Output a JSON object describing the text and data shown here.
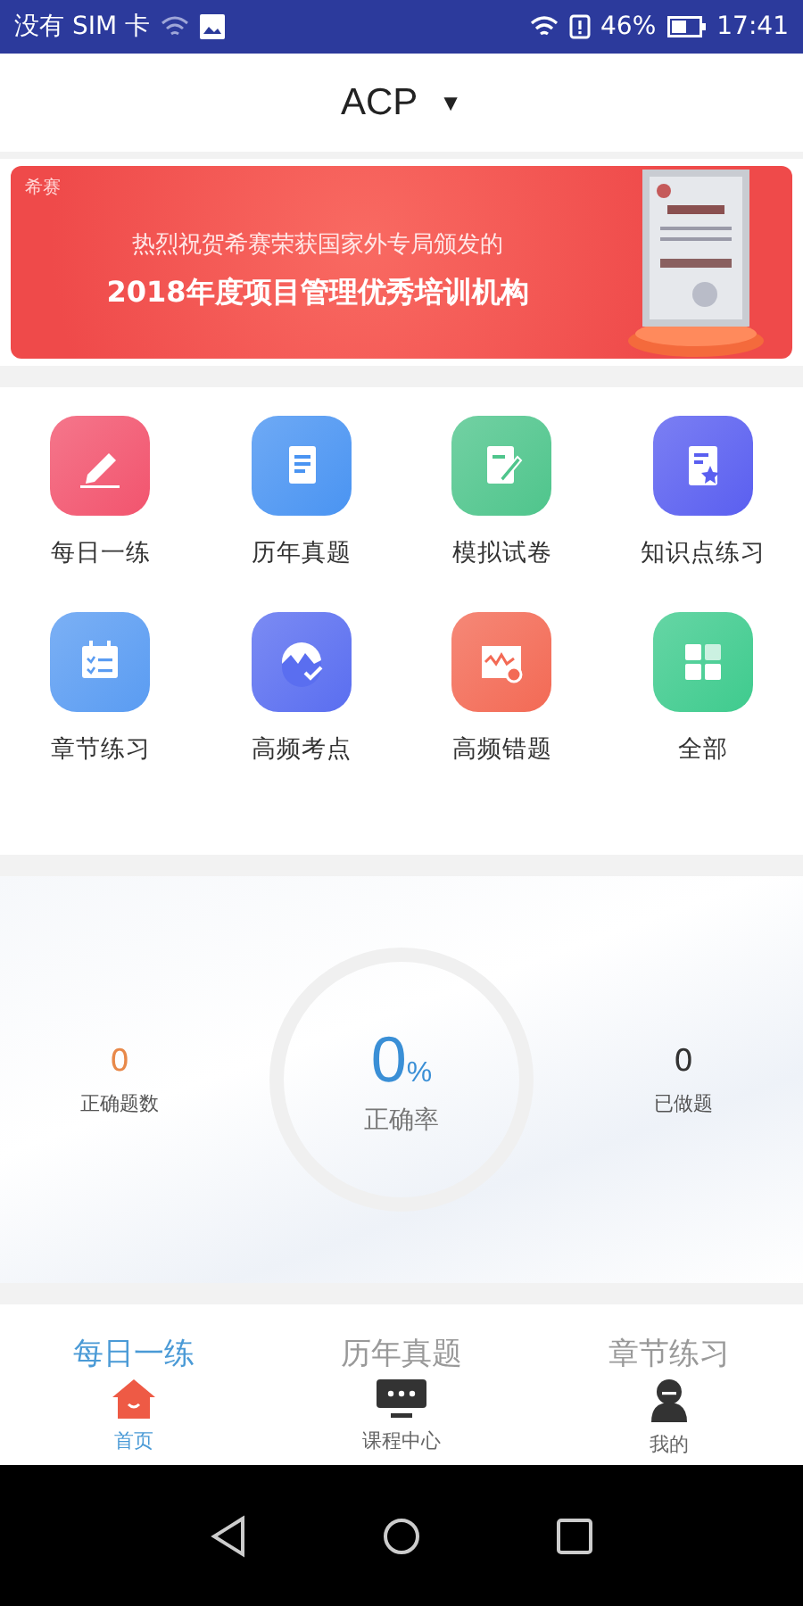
{
  "status_bar": {
    "carrier": "没有 SIM 卡",
    "battery": "46%",
    "time": "17:41"
  },
  "header": {
    "title": "ACP",
    "caret": "▼"
  },
  "banner": {
    "logo": "希赛",
    "line1": "热烈祝贺希赛荣获国家外专局颁发的",
    "line2": "2018年度项目管理优秀培训机构"
  },
  "grid": [
    {
      "label": "每日一练",
      "color": "#f2546e"
    },
    {
      "label": "历年真题",
      "color": "#4a94f2"
    },
    {
      "label": "模拟试卷",
      "color": "#4fc58c"
    },
    {
      "label": "知识点练习",
      "color": "#5a5ff0"
    },
    {
      "label": "章节练习",
      "color": "#5a9cf2"
    },
    {
      "label": "高频考点",
      "color": "#5a6ef0"
    },
    {
      "label": "高频错题",
      "color": "#f36a55"
    },
    {
      "label": "全部",
      "color": "#3fcb8e"
    }
  ],
  "stats": {
    "correct": {
      "value": "0",
      "label": "正确题数"
    },
    "rate": {
      "value": "0",
      "unit": "%",
      "label": "正确率"
    },
    "done": {
      "value": "0",
      "label": "已做题"
    }
  },
  "tabs": [
    {
      "label": "每日一练",
      "selected": true
    },
    {
      "label": "历年真题",
      "selected": false
    },
    {
      "label": "章节练习",
      "selected": false
    }
  ],
  "bottom_nav": [
    {
      "label": "首页",
      "selected": true
    },
    {
      "label": "课程中心",
      "selected": false
    },
    {
      "label": "我的",
      "selected": false
    }
  ]
}
